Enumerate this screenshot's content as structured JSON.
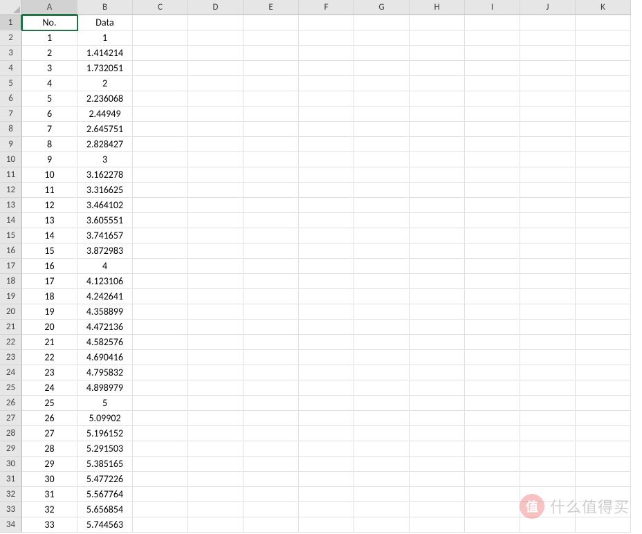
{
  "columns": [
    "A",
    "B",
    "C",
    "D",
    "E",
    "F",
    "G",
    "H",
    "I",
    "J",
    "K"
  ],
  "selectedCell": "A1",
  "headers": {
    "A": "No.",
    "B": "Data"
  },
  "rows": [
    {
      "n": "1",
      "d": "1"
    },
    {
      "n": "2",
      "d": "1.414214"
    },
    {
      "n": "3",
      "d": "1.732051"
    },
    {
      "n": "4",
      "d": "2"
    },
    {
      "n": "5",
      "d": "2.236068"
    },
    {
      "n": "6",
      "d": "2.44949"
    },
    {
      "n": "7",
      "d": "2.645751"
    },
    {
      "n": "8",
      "d": "2.828427"
    },
    {
      "n": "9",
      "d": "3"
    },
    {
      "n": "10",
      "d": "3.162278"
    },
    {
      "n": "11",
      "d": "3.316625"
    },
    {
      "n": "12",
      "d": "3.464102"
    },
    {
      "n": "13",
      "d": "3.605551"
    },
    {
      "n": "14",
      "d": "3.741657"
    },
    {
      "n": "15",
      "d": "3.872983"
    },
    {
      "n": "16",
      "d": "4"
    },
    {
      "n": "17",
      "d": "4.123106"
    },
    {
      "n": "18",
      "d": "4.242641"
    },
    {
      "n": "19",
      "d": "4.358899"
    },
    {
      "n": "20",
      "d": "4.472136"
    },
    {
      "n": "21",
      "d": "4.582576"
    },
    {
      "n": "22",
      "d": "4.690416"
    },
    {
      "n": "23",
      "d": "4.795832"
    },
    {
      "n": "24",
      "d": "4.898979"
    },
    {
      "n": "25",
      "d": "5"
    },
    {
      "n": "26",
      "d": "5.09902"
    },
    {
      "n": "27",
      "d": "5.196152"
    },
    {
      "n": "28",
      "d": "5.291503"
    },
    {
      "n": "29",
      "d": "5.385165"
    },
    {
      "n": "30",
      "d": "5.477226"
    },
    {
      "n": "31",
      "d": "5.567764"
    },
    {
      "n": "32",
      "d": "5.656854"
    },
    {
      "n": "33",
      "d": "5.744563"
    }
  ],
  "visibleRowCount": 34,
  "watermark": {
    "badge": "值",
    "text": "什么值得买"
  }
}
